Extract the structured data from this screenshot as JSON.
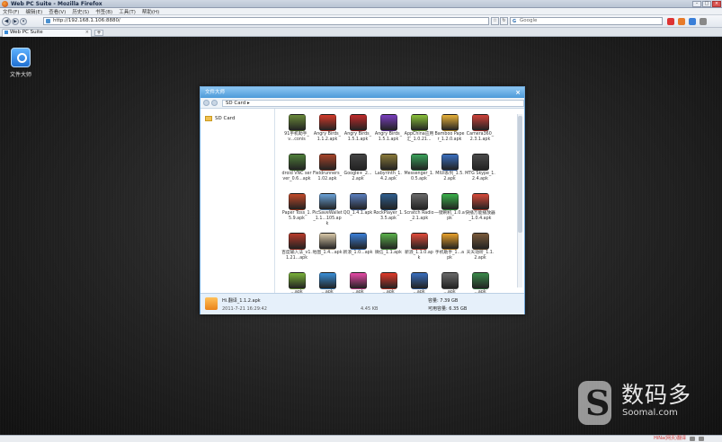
{
  "browser": {
    "title": "Web PC Suite - Mozilla Firefox",
    "menu": [
      "文件(F)",
      "编辑(E)",
      "查看(V)",
      "历史(S)",
      "书签(B)",
      "工具(T)",
      "帮助(H)"
    ],
    "url": "http://192.168.1.106:8880/",
    "search_placeholder": "Google",
    "search_engine_glyph": "G",
    "tab_label": "Web PC Suite",
    "statusbar_text": "HiNa(网页)翻译"
  },
  "desktop": {
    "icons": [
      {
        "label": "文件大师",
        "icon": "file-manager-icon"
      }
    ]
  },
  "file_manager": {
    "title": "文件大师",
    "breadcrumb": "SD Card ▸",
    "tree": [
      {
        "label": "SD Card",
        "icon": "folder-icon"
      }
    ],
    "files": [
      {
        "name": "91手机助手_v...conis",
        "color": "#6a8a3a"
      },
      {
        "name": "Angry Birds_1.1.2.apk",
        "color": "#d33a2a"
      },
      {
        "name": "Angry Birds_1.5.1.apk",
        "color": "#c22b2b"
      },
      {
        "name": "Angry Birds_1.5.1.apk",
        "color": "#7a3fbf"
      },
      {
        "name": "AppChina应用汇_1.0.21...",
        "color": "#8ac23a"
      },
      {
        "name": "Bamboo Paper_1.2.0.apk",
        "color": "#e8b23a"
      },
      {
        "name": "Camera360_2.3.1.apk",
        "color": "#d0423a"
      },
      {
        "name": "droid VNC server_0.6...apk",
        "color": "#4f7f3a"
      },
      {
        "name": "Fieldrunners_1.02.apk",
        "color": "#a8442a"
      },
      {
        "name": "Google+_2...2.apk",
        "color": "#444444"
      },
      {
        "name": "Labyrinth_1.4.2.apk",
        "color": "#8a7a3a"
      },
      {
        "name": "Messenger_1.0.5.apk",
        "color": "#3aa25a"
      },
      {
        "name": "MIUI系列_1.5.2.apk",
        "color": "#3a6fbf"
      },
      {
        "name": "MTG Skype_1.2.4.apk",
        "color": "#4a4a4a"
      },
      {
        "name": "Paper Toss_1.5.9.apk",
        "color": "#c24a2a"
      },
      {
        "name": "PicSaveWallet_1.1...105.apk",
        "color": "#6aa2d8"
      },
      {
        "name": "QQ_1.4.1.apk",
        "color": "#5a7fc0"
      },
      {
        "name": "RockPlayer_1.3.5.apk",
        "color": "#2f5f8f"
      },
      {
        "name": "Scratch Radio_2.1.apk",
        "color": "#6a6a6a"
      },
      {
        "name": "一键刷机_1.0.apk",
        "color": "#3ab24a"
      },
      {
        "name": "快播万能播放器_1.0.4.apk",
        "color": "#d84a3a"
      },
      {
        "name": "百度输入法_v1.1.21...apk",
        "color": "#b83a2a"
      },
      {
        "name": "地图_1.4...apk",
        "color": "#d8c8a8"
      },
      {
        "name": "新浪_1.0...apk",
        "color": "#3a7fd8"
      },
      {
        "name": "微信_1.1.apk",
        "color": "#5ab24a"
      },
      {
        "name": "新浪_1.1.0.apk",
        "color": "#e24a3a"
      },
      {
        "name": "手机助手_1...apk",
        "color": "#e8a02a"
      },
      {
        "name": "天天动听_1.1.2.apk",
        "color": "#7a5a3a"
      },
      {
        "name": "...apk",
        "color": "#7ab23a"
      },
      {
        "name": "...apk",
        "color": "#3a8fd8"
      },
      {
        "name": "...apk",
        "color": "#e84aa8"
      },
      {
        "name": "...apk",
        "color": "#e23a2a"
      },
      {
        "name": "...apk",
        "color": "#3a6fbf"
      },
      {
        "name": "...apk",
        "color": "#6a6a6a"
      },
      {
        "name": "...apk",
        "color": "#3a8a4a"
      }
    ],
    "status": {
      "selected_name": "Hi.翻译_1.1.2.apk",
      "time": "2011-7-21 16:29:42",
      "size": "4.45 KB",
      "total": "容量: 7.39 GB",
      "available": "可用容量: 6.35 GB"
    }
  },
  "watermark": {
    "cn": "数码多",
    "en": "Soomal.com"
  }
}
